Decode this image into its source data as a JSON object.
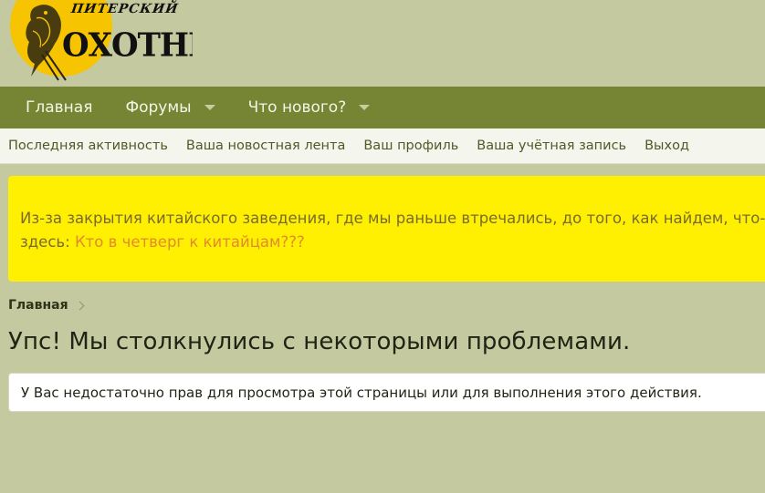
{
  "logo": {
    "line1": "ПИТЕРСКИЙ",
    "line2": "ОХОТНИК"
  },
  "nav": {
    "items": [
      {
        "label": "Главная",
        "has_dropdown": false
      },
      {
        "label": "Форумы",
        "has_dropdown": true
      },
      {
        "label": "Что нового?",
        "has_dropdown": true
      }
    ]
  },
  "subnav": {
    "items": [
      {
        "label": "Последняя активность"
      },
      {
        "label": "Ваша новостная лента"
      },
      {
        "label": "Ваш профиль"
      },
      {
        "label": "Ваша учётная запись"
      },
      {
        "label": "Выход"
      }
    ]
  },
  "notice": {
    "text_line1": "Из-за закрытия китайского заведения, где мы раньше втречались, до того, как найдем, что-то",
    "text_line2_prefix": "здесь: ",
    "link_text": "Кто в четверг к китайцам???"
  },
  "breadcrumb": {
    "home": "Главная"
  },
  "page": {
    "title": "Упс! Мы столкнулись с некоторыми проблемами.",
    "error_message": "У Вас недостаточно прав для просмотра этой страницы или для выполнения этого действия."
  },
  "colors": {
    "background": "#c4c9a0",
    "nav_bg": "#768534",
    "subnav_bg": "#f4f5ec",
    "notice_bg": "#ffef00",
    "notice_link": "#e08c2e",
    "logo_sun": "#f6c400"
  }
}
